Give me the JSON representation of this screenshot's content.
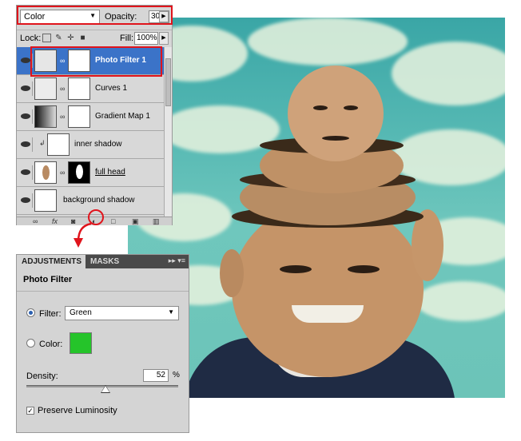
{
  "layers_panel": {
    "blend_mode": "Color",
    "opacity_label": "Opacity:",
    "opacity_value": "30%",
    "lock_label": "Lock:",
    "fill_label": "Fill:",
    "fill_value": "100%",
    "layers": [
      {
        "name": "Photo Filter 1",
        "selected": true,
        "thumb": "adjustment-photo-filter"
      },
      {
        "name": "Curves 1",
        "selected": false,
        "thumb": "adjustment-curves"
      },
      {
        "name": "Gradient Map 1",
        "selected": false,
        "thumb": "adjustment-gradient-map"
      },
      {
        "name": "inner shadow",
        "selected": false,
        "thumb": "transparent"
      },
      {
        "name": "full head",
        "selected": false,
        "thumb": "image-with-mask"
      },
      {
        "name": "background shadow",
        "selected": false,
        "thumb": "transparent"
      }
    ],
    "bottom_icons": [
      "link-icon",
      "fx-icon",
      "mask-icon",
      "adjustment-icon",
      "folder-icon",
      "new-layer-icon",
      "trash-icon"
    ]
  },
  "adjustments_panel": {
    "tab_active": "ADJUSTMENTS",
    "tab_inactive": "MASKS",
    "title": "Photo Filter",
    "filter_label": "Filter:",
    "filter_value": "Green",
    "color_label": "Color:",
    "color_swatch": "#25c42a",
    "density_label": "Density:",
    "density_value": "52",
    "density_unit": "%",
    "density_fraction": 0.52,
    "preserve_luminosity_label": "Preserve Luminosity",
    "preserve_luminosity_checked": true
  },
  "colors": {
    "highlight_red": "#e0141c",
    "selection_blue": "#3b73c8"
  }
}
